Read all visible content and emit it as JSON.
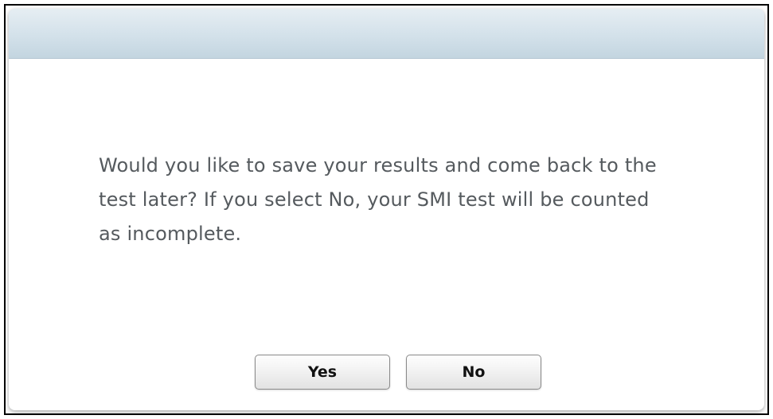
{
  "dialog": {
    "message": "Would you like to save your results and come back to the test later?  If you select No, your SMI test will be counted as incomplete.",
    "yes_label": "Yes",
    "no_label": "No"
  },
  "colors": {
    "header_gradient_top": "#e6eef3",
    "header_gradient_bottom": "#c3d5e0",
    "message_text": "#555a5e",
    "button_text": "#111111"
  }
}
